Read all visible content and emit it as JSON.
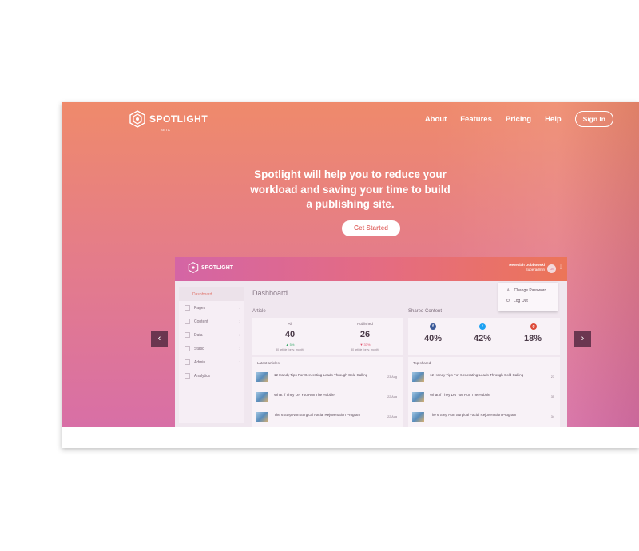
{
  "brand": {
    "name": "SPOTLIGHT",
    "tag": "BETA"
  },
  "nav": {
    "items": [
      "About",
      "Features",
      "Pricing",
      "Help"
    ],
    "signin": "Sign In"
  },
  "hero": {
    "headline_lines": [
      "Spotlight will help you to reduce your",
      "workload and saving your time to build",
      "a publishing site."
    ],
    "cta": "Get Started"
  },
  "carousel": {
    "prev_glyph": "‹",
    "next_glyph": "›"
  },
  "dashboard": {
    "brand": "SPOTLIGHT",
    "user_name": "Hezekiah Dobbowski",
    "user_role": "Superadmin",
    "avatar_initials": "Gt",
    "dropdown": {
      "change_password": "Change Password",
      "log_out": "Log Out"
    },
    "sidebar": [
      "Dashboard",
      "Pages",
      "Content",
      "Data",
      "Static",
      "Admin",
      "Analytics"
    ],
    "title": "Dashboard",
    "article": {
      "label": "Article",
      "all_label": "All",
      "all_value": "40",
      "all_change": "▲ 5%",
      "all_sub": "30 article (prev. month)",
      "pub_label": "Published",
      "pub_value": "26",
      "pub_change": "▼ 33%",
      "pub_sub": "30 article (prev. month)",
      "latest_label": "Latest articles",
      "latest": [
        {
          "title": "12 Handy Tips For Generating Leads Through Cold Calling",
          "date": "23 Aug"
        },
        {
          "title": "What If They Let You Run The Hubble",
          "date": "22 Aug"
        },
        {
          "title": "The 6 Step Non Surgical Facial Rejuvenation Program",
          "date": "22 Aug"
        }
      ]
    },
    "shared": {
      "label": "Shared Content",
      "facebook": "40%",
      "twitter": "42%",
      "google": "18%",
      "top_label": "Top shared",
      "top": [
        {
          "title": "12 Handy Tips For Generating Leads Through Cold Calling",
          "count": "23"
        },
        {
          "title": "What If They Let You Run The Hubble",
          "count": "35"
        },
        {
          "title": "The 6 Step Non Surgical Facial Rejuvenation Program",
          "count": "34"
        }
      ]
    }
  },
  "colors": {
    "hero_top": "#ef8a6b",
    "hero_bottom": "#d86fa6",
    "arrow_bg": "#6b3650",
    "cta_text": "#e2716e"
  },
  "icons": [
    "spotlight-logo-icon",
    "chevron-left-icon",
    "chevron-right-icon",
    "facebook-icon",
    "twitter-icon",
    "google-plus-icon",
    "user-icon",
    "logout-icon",
    "kebab-icon"
  ]
}
